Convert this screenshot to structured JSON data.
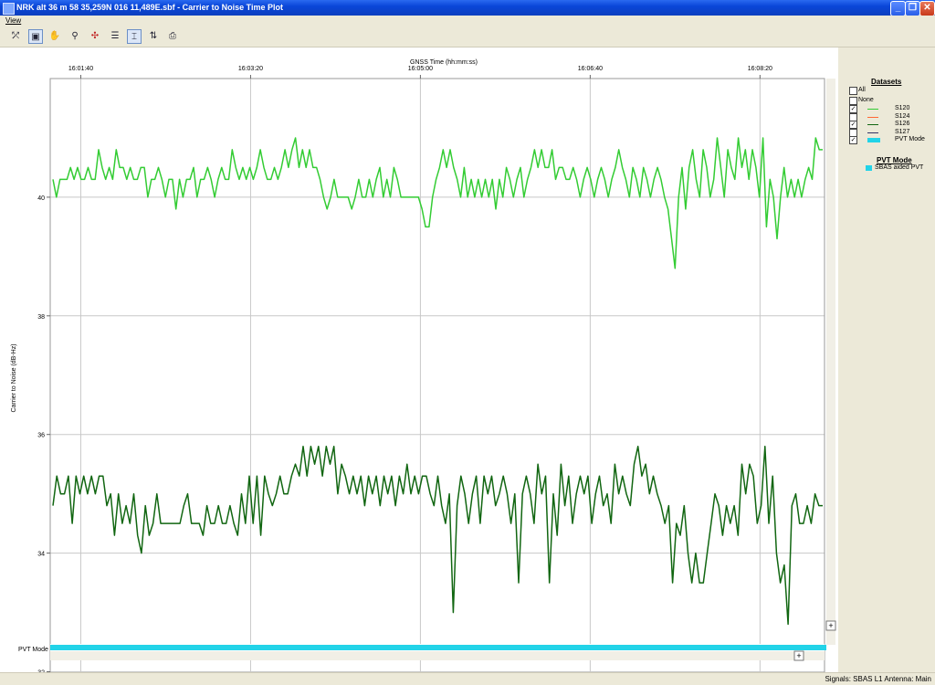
{
  "window": {
    "title": "NRK alt 36 m 58 35,259N 016 11,489E.sbf - Carrier to Noise Time Plot",
    "controls": {
      "minimize": "_",
      "restore": "❐",
      "close": "✕"
    }
  },
  "menu": {
    "items": [
      {
        "label": "View"
      }
    ]
  },
  "toolbar": {
    "buttons": [
      {
        "icon": "select-icon"
      },
      {
        "icon": "zoom-box-icon"
      },
      {
        "icon": "hand-pan-icon"
      },
      {
        "icon": "measure-icon"
      },
      {
        "icon": "fit-all-icon"
      },
      {
        "icon": "horizontal-scale-icon"
      },
      {
        "icon": "vertical-scale-icon"
      },
      {
        "icon": "swap-axes-icon"
      },
      {
        "icon": "print-icon"
      }
    ]
  },
  "legend": {
    "datasets_title": "Datasets",
    "items": [
      {
        "label": "All",
        "checked": false,
        "color": ""
      },
      {
        "label": "None",
        "checked": false,
        "color": ""
      },
      {
        "label": "S120",
        "checked": true,
        "color": "#33cc33"
      },
      {
        "label": "S124",
        "checked": false,
        "color": "#ff6633"
      },
      {
        "label": "S126",
        "checked": true,
        "color": "#116611"
      },
      {
        "label": "S127",
        "checked": false,
        "color": "#333366"
      },
      {
        "label": "PVT Mode",
        "checked": true,
        "color": "#22d3e8"
      }
    ],
    "pvt_title": "PVT Mode",
    "pvt_items": [
      {
        "label": "SBAS aided PVT",
        "color": "#22d3e8"
      }
    ]
  },
  "status": {
    "text": "Signals: SBAS L1    Antenna: Main"
  },
  "chart_data": {
    "type": "line",
    "title": "",
    "xlabel": "GNSS Time (hh:mm:ss)",
    "ylabel": "Carrier to Noise (dB-Hz)",
    "x_ticks": [
      "16:01:40",
      "16:03:20",
      "16:05:00",
      "16:06:40",
      "16:08:20"
    ],
    "x_range": [
      "16:01:22",
      "16:08:58"
    ],
    "y_ticks": [
      32,
      34,
      36,
      38,
      40
    ],
    "ylim": [
      31.9,
      42
    ],
    "grid": true,
    "series": [
      {
        "name": "S120",
        "color": "#33cc33",
        "values": [
          40.3,
          40.0,
          40.3,
          40.3,
          40.3,
          40.5,
          40.3,
          40.5,
          40.3,
          40.3,
          40.5,
          40.3,
          40.3,
          40.8,
          40.5,
          40.3,
          40.5,
          40.3,
          40.8,
          40.5,
          40.5,
          40.3,
          40.5,
          40.3,
          40.3,
          40.5,
          40.5,
          40.0,
          40.3,
          40.3,
          40.5,
          40.3,
          40.0,
          40.3,
          40.3,
          39.8,
          40.3,
          40.0,
          40.3,
          40.3,
          40.5,
          40.0,
          40.3,
          40.3,
          40.5,
          40.3,
          40.0,
          40.3,
          40.5,
          40.3,
          40.3,
          40.8,
          40.5,
          40.3,
          40.5,
          40.3,
          40.5,
          40.3,
          40.5,
          40.8,
          40.5,
          40.3,
          40.3,
          40.5,
          40.3,
          40.5,
          40.8,
          40.5,
          40.8,
          41.0,
          40.5,
          40.8,
          40.5,
          40.8,
          40.5,
          40.5,
          40.3,
          40.0,
          39.8,
          40.0,
          40.3,
          40.0,
          40.0,
          40.0,
          40.0,
          39.8,
          40.0,
          40.3,
          40.0,
          40.0,
          40.3,
          40.0,
          40.3,
          40.5,
          40.0,
          40.3,
          40.0,
          40.5,
          40.3,
          40.0,
          40.0,
          40.0,
          40.0,
          40.0,
          40.0,
          39.8,
          39.5,
          39.5,
          40.0,
          40.3,
          40.5,
          40.8,
          40.5,
          40.8,
          40.5,
          40.3,
          40.0,
          40.5,
          40.0,
          40.3,
          40.0,
          40.3,
          40.0,
          40.3,
          40.0,
          40.3,
          39.8,
          40.3,
          40.0,
          40.5,
          40.3,
          40.0,
          40.3,
          40.5,
          40.0,
          40.3,
          40.5,
          40.8,
          40.5,
          40.8,
          40.5,
          40.5,
          40.8,
          40.3,
          40.5,
          40.5,
          40.3,
          40.3,
          40.5,
          40.3,
          40.0,
          40.3,
          40.5,
          40.3,
          40.0,
          40.3,
          40.5,
          40.3,
          40.0,
          40.3,
          40.5,
          40.8,
          40.5,
          40.3,
          40.0,
          40.5,
          40.3,
          40.0,
          40.5,
          40.3,
          40.0,
          40.3,
          40.5,
          40.3,
          40.0,
          39.8,
          39.3,
          38.8,
          40.0,
          40.5,
          39.8,
          40.5,
          40.8,
          40.3,
          40.0,
          40.8,
          40.5,
          40.0,
          40.3,
          41.0,
          40.5,
          40.0,
          40.8,
          40.5,
          40.3,
          41.0,
          40.5,
          40.8,
          40.3,
          40.8,
          40.5,
          40.0,
          41.0,
          39.5,
          40.3,
          40.0,
          39.3,
          40.0,
          40.5,
          40.0,
          40.3,
          40.0,
          40.3,
          40.0,
          40.3,
          40.5,
          40.3,
          41.0,
          40.8,
          40.8
        ]
      },
      {
        "name": "S126",
        "color": "#116611",
        "values": [
          34.8,
          35.3,
          35.0,
          35.0,
          35.3,
          34.5,
          35.3,
          35.0,
          35.3,
          35.0,
          35.3,
          35.0,
          35.3,
          35.3,
          34.8,
          35.0,
          34.3,
          35.0,
          34.5,
          34.8,
          34.5,
          35.0,
          34.3,
          34.0,
          34.8,
          34.3,
          34.5,
          35.0,
          34.5,
          34.5,
          34.5,
          34.5,
          34.5,
          34.5,
          34.8,
          35.0,
          34.5,
          34.5,
          34.5,
          34.3,
          34.8,
          34.5,
          34.5,
          34.8,
          34.5,
          34.5,
          34.8,
          34.5,
          34.3,
          35.0,
          34.5,
          35.3,
          34.5,
          35.3,
          34.3,
          35.3,
          35.0,
          34.8,
          35.0,
          35.3,
          35.0,
          35.0,
          35.3,
          35.5,
          35.3,
          35.8,
          35.3,
          35.8,
          35.5,
          35.8,
          35.3,
          35.8,
          35.5,
          35.8,
          35.0,
          35.5,
          35.3,
          35.0,
          35.3,
          35.0,
          35.3,
          34.8,
          35.3,
          35.0,
          35.3,
          34.8,
          35.3,
          35.0,
          35.3,
          34.8,
          35.3,
          35.0,
          35.5,
          35.0,
          35.3,
          35.0,
          35.3,
          35.3,
          35.0,
          34.8,
          35.3,
          34.8,
          34.5,
          35.0,
          33.0,
          34.8,
          35.3,
          35.0,
          34.5,
          35.0,
          35.3,
          34.5,
          35.3,
          35.0,
          35.3,
          34.8,
          35.0,
          35.3,
          35.0,
          34.5,
          35.0,
          33.5,
          35.0,
          35.3,
          35.0,
          34.5,
          35.5,
          35.0,
          35.3,
          33.5,
          35.0,
          34.3,
          35.5,
          34.8,
          35.3,
          34.5,
          35.0,
          35.3,
          35.0,
          35.3,
          34.5,
          35.0,
          35.3,
          34.8,
          35.0,
          34.5,
          35.5,
          35.0,
          35.3,
          35.0,
          34.8,
          35.5,
          35.8,
          35.3,
          35.5,
          35.0,
          35.3,
          35.0,
          34.8,
          34.5,
          34.8,
          33.5,
          34.5,
          34.3,
          34.8,
          34.0,
          33.5,
          34.0,
          33.5,
          33.5,
          34.0,
          34.5,
          35.0,
          34.8,
          34.3,
          34.8,
          34.5,
          34.8,
          34.3,
          35.5,
          35.0,
          35.5,
          35.3,
          34.5,
          34.8,
          35.8,
          34.5,
          35.3,
          34.0,
          33.5,
          33.8,
          32.8,
          34.8,
          35.0,
          34.5,
          34.5,
          34.8,
          34.5,
          35.0,
          34.8,
          34.8
        ]
      }
    ],
    "pvt_mode_band": {
      "label": "PVT Mode",
      "value": "SBAS aided PVT",
      "color": "#22d3e8"
    }
  }
}
